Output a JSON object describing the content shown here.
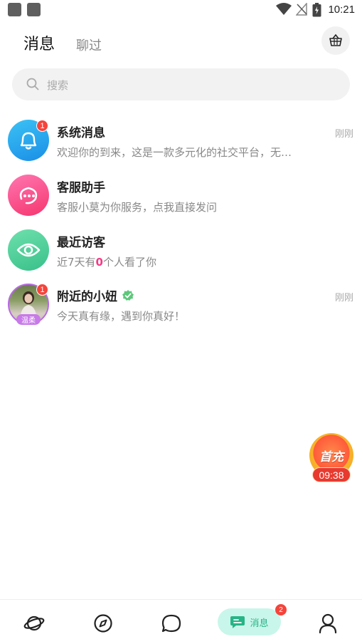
{
  "status_bar": {
    "time": "10:21"
  },
  "header": {
    "tabs": [
      {
        "label": "消息",
        "active": true
      },
      {
        "label": "聊过",
        "active": false
      }
    ],
    "basket_icon": "basket-icon"
  },
  "search": {
    "placeholder": "搜索",
    "icon": "search-icon"
  },
  "messages": [
    {
      "title": "系统消息",
      "subtitle": "欢迎你的到来，这是一款多元化的社交平台，无…",
      "time": "刚刚",
      "badge": "1",
      "icon": "bell-icon",
      "color": "#1a8ee6"
    },
    {
      "title": "客服助手",
      "subtitle": "客服小莫为你服务，点我直接发问",
      "time": "",
      "badge": "",
      "icon": "headset-icon",
      "color": "#f5366f"
    },
    {
      "title": "最近访客",
      "subtitle_prefix": "近7天有",
      "subtitle_count": "0",
      "subtitle_suffix": "个人看了你",
      "time": "",
      "badge": "",
      "icon": "eye-icon",
      "color": "#39c08a"
    },
    {
      "title": "附近的小妞",
      "subtitle": "今天真有缘，遇到你真好！",
      "time": "刚刚",
      "badge": "1",
      "tag": "温柔",
      "verified": true,
      "icon": "verified-icon"
    }
  ],
  "promo": {
    "label": "首充",
    "timer": "09:38"
  },
  "bottom_nav": {
    "items": [
      {
        "icon": "planet-icon"
      },
      {
        "icon": "compass-icon"
      },
      {
        "icon": "bubble-icon"
      },
      {
        "icon": "message-icon",
        "label": "消息",
        "badge": "2",
        "active": true
      },
      {
        "icon": "profile-icon"
      }
    ]
  },
  "colors": {
    "accent": "#27b486",
    "badge": "#f5443b",
    "highlight": "#f43a86"
  }
}
